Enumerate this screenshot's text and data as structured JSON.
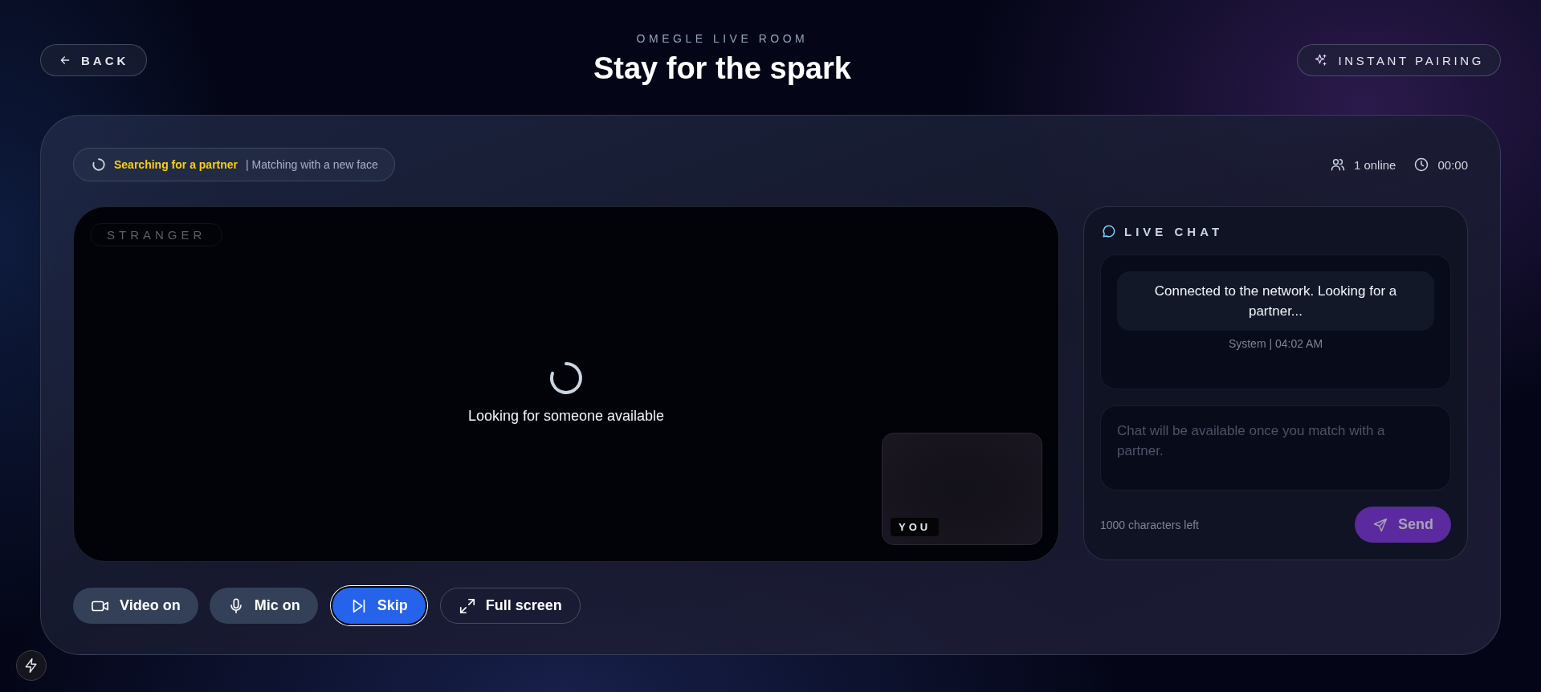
{
  "header": {
    "back": {
      "label": "BACK"
    },
    "eyebrow": "OMEGLE LIVE ROOM",
    "title": "Stay for the spark",
    "pairing": {
      "label": "INSTANT PAIRING"
    }
  },
  "status": {
    "searching": true,
    "state": "Searching for a partner",
    "detail": "| Matching with a new face"
  },
  "stats": [
    {
      "kind": "users",
      "text": "1 online"
    },
    {
      "kind": "clock",
      "text": "00:00"
    }
  ],
  "video": {
    "stranger_label": "STRANGER",
    "loading_text": "Looking for someone available",
    "self_label": "YOU"
  },
  "chat": {
    "title": "LIVE CHAT",
    "messages": [
      {
        "text": "Connected to the network. Looking for a partner...",
        "meta": "System | 04:02 AM"
      }
    ],
    "input": {
      "placeholder": "Chat will be available once you match with a partner."
    },
    "counter": "1000 characters left",
    "send": {
      "label": "Send",
      "disabled": true
    }
  },
  "controls": [
    {
      "kind": "video",
      "label": "Video on"
    },
    {
      "kind": "mic",
      "label": "Mic on"
    },
    {
      "kind": "skip",
      "label": "Skip"
    },
    {
      "kind": "fullscreen",
      "label": "Full screen"
    }
  ]
}
